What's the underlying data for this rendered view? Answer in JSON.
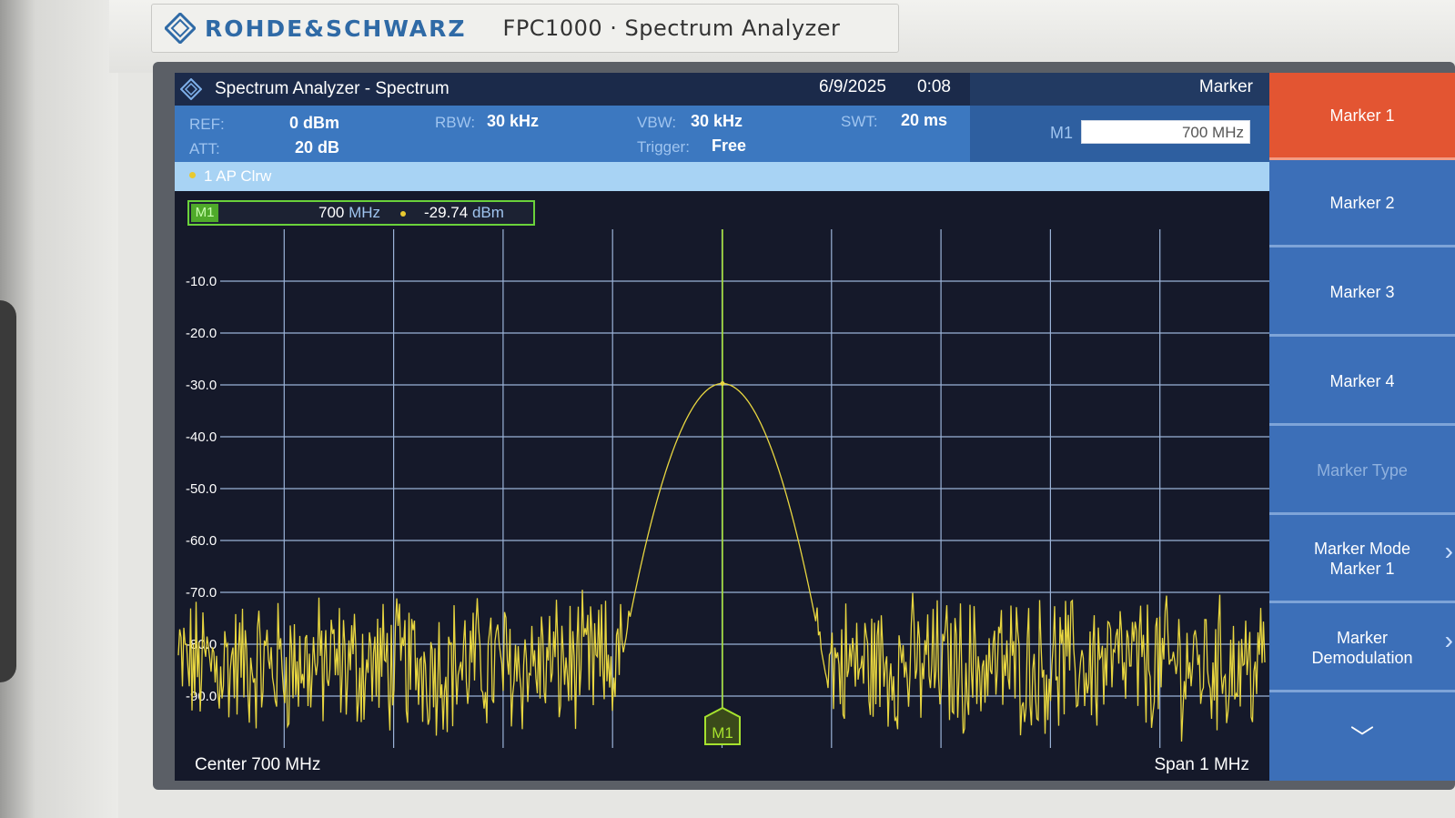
{
  "brand": {
    "name": "ROHDE&SCHWARZ",
    "model": "FPC1000 · Spectrum Analyzer"
  },
  "titlebar": {
    "title": "Spectrum Analyzer - Spectrum",
    "date": "6/9/2025",
    "time": "0:08",
    "menu": "Marker"
  },
  "params": {
    "ref_label": "REF:",
    "ref_value": "0 dBm",
    "att_label": "ATT:",
    "att_value": "20 dB",
    "rbw_label": "RBW:",
    "rbw_value": "30 kHz",
    "vbw_label": "VBW:",
    "vbw_value": "30 kHz",
    "trigger_label": "Trigger:",
    "trigger_value": "Free",
    "swt_label": "SWT:",
    "swt_value": "20 ms"
  },
  "marker_input": {
    "label": "M1",
    "value": "700 MHz"
  },
  "trace": {
    "label": "1 AP  Clrw"
  },
  "readout": {
    "tag": "M1",
    "freq": "700",
    "freq_unit": "MHz",
    "level": "-29.74",
    "level_unit": "dBm"
  },
  "chart_data": {
    "type": "line",
    "y_ticks": [
      "-10.0",
      "-20.0",
      "-30.0",
      "-40.0",
      "-50.0",
      "-60.0",
      "-70.0",
      "-80.0",
      "-90.0"
    ],
    "ylim": [
      -100,
      0
    ],
    "x_center": "Center 700 MHz",
    "x_span": "Span 1 MHz",
    "peak": {
      "x": 700,
      "y": -29.74
    },
    "noise_floor": -84,
    "grid": true,
    "marker": {
      "label": "M1",
      "x": 700,
      "y": -29.74
    },
    "colors": {
      "trace": "#e8d640",
      "marker": "#a6e22e",
      "grid": "#9bb3d8"
    }
  },
  "footer": {
    "center": "Center 700 MHz",
    "span": "Span 1 MHz"
  },
  "softkeys": [
    {
      "label": "Marker 1",
      "state": "active"
    },
    {
      "label": "Marker 2",
      "state": "normal"
    },
    {
      "label": "Marker 3",
      "state": "normal"
    },
    {
      "label": "Marker 4",
      "state": "normal"
    },
    {
      "label": "Marker Type",
      "state": "disabled"
    },
    {
      "label": "Marker Mode\nMarker 1",
      "state": "submenu"
    },
    {
      "label": "Marker\nDemodulation",
      "state": "submenu"
    },
    {
      "label": "﹀",
      "state": "more"
    }
  ]
}
